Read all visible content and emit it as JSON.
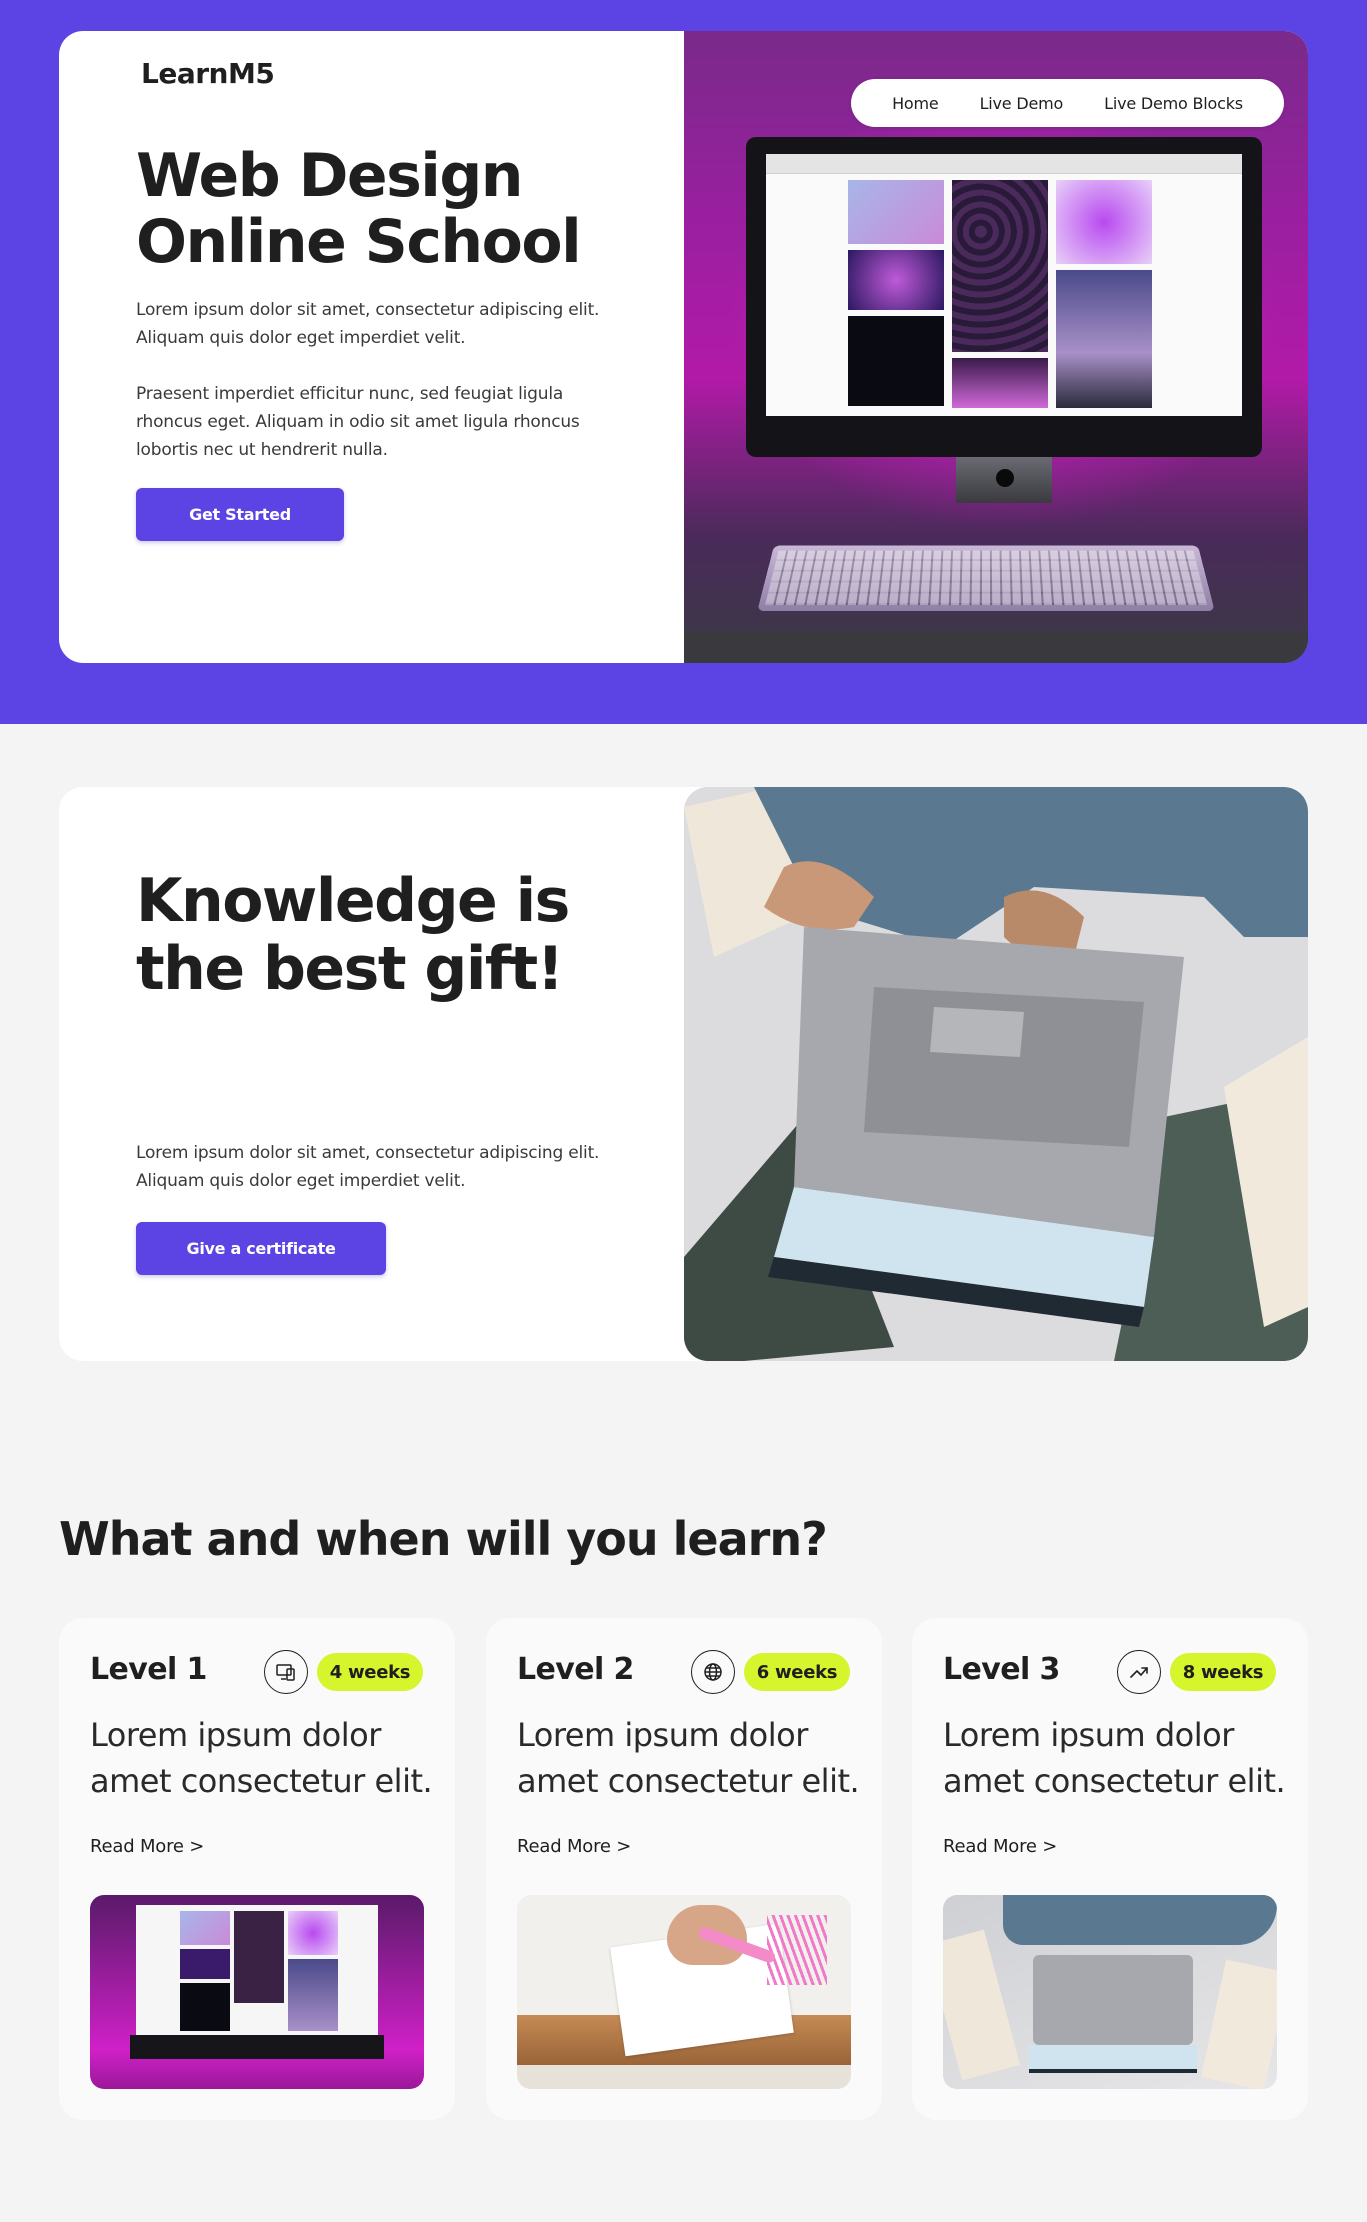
{
  "brand": {
    "logo": "LearnM5",
    "accent": "#5c44e4",
    "badge_color": "#d6f52d"
  },
  "nav": {
    "items": [
      "Home",
      "Live Demo",
      "Live Demo Blocks"
    ]
  },
  "hero": {
    "title": "Web Design Online School",
    "paragraph1": "Lorem ipsum dolor sit amet, consectetur adipiscing elit. Aliquam quis dolor eget imperdiet velit.",
    "paragraph2": "Praesent imperdiet efficitur nunc, sed feugiat ligula rhoncus eget. Aliquam in odio sit amet ligula rhoncus lobortis nec ut hendrerit nulla.",
    "cta_label": "Get Started",
    "image": "desktop-computer-with-pink-neon-lighting"
  },
  "knowledge": {
    "title": "Knowledge is the best gift!",
    "paragraph": "Lorem ipsum dolor sit amet, consectetur adipiscing elit. Aliquam quis dolor eget imperdiet velit.",
    "cta_label": "Give a certificate",
    "image": "person-with-laptop-and-books-on-bed"
  },
  "levels": {
    "title": "What and when will you learn?",
    "items": [
      {
        "name": "Level 1",
        "icon": "devices-icon",
        "duration": "4 weeks",
        "description": "Lorem ipsum dolor amet consectetur elit.",
        "link": "Read More >"
      },
      {
        "name": "Level 2",
        "icon": "globe-icon",
        "duration": "6 weeks",
        "description": "Lorem ipsum dolor amet consectetur elit.",
        "link": "Read More >"
      },
      {
        "name": "Level 3",
        "icon": "trend-up-icon",
        "duration": "8 weeks",
        "description": "Lorem ipsum dolor amet consectetur elit.",
        "link": "Read More >"
      }
    ]
  }
}
